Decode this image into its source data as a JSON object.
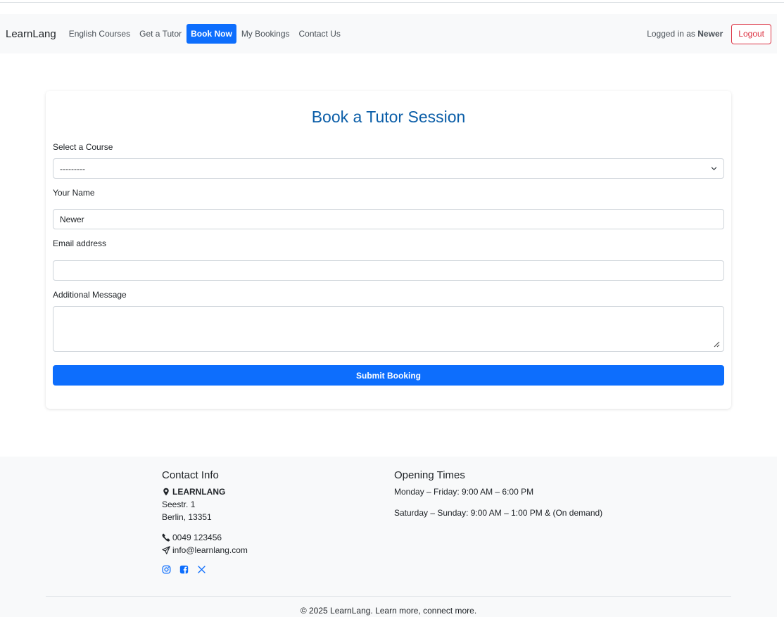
{
  "nav": {
    "brand": "LearnLang",
    "links": [
      "English Courses",
      "Get a Tutor",
      "Book Now",
      "My Bookings",
      "Contact Us"
    ],
    "active_link": "Book Now",
    "logged_in_prefix": "Logged in as",
    "username": "Newer",
    "logout_label": "Logout"
  },
  "form": {
    "title": "Book a Tutor Session",
    "course_label": "Select a Course",
    "course_value": "---------",
    "name_label": "Your Name",
    "name_value": "Newer",
    "email_label": "Email address",
    "email_value": "",
    "message_label": "Additional Message",
    "message_value": "",
    "submit_label": "Submit Booking"
  },
  "footer": {
    "contact_heading": "Contact Info",
    "company": "LEARNLANG",
    "street": "Seestr. 1",
    "city": "Berlin, 13351",
    "phone": "0049 123456",
    "email": "info@learnlang.com",
    "hours_heading": "Opening Times",
    "weekday_hours": "Monday – Friday: 9:00 AM – 6:00 PM",
    "weekend_hours": "Saturday – Sunday: 9:00 AM – 1:00 PM & (On demand)",
    "copyright": "© 2025 LearnLang. Learn more, connect more.",
    "socials": [
      "instagram-icon",
      "facebook-icon",
      "x-icon"
    ]
  },
  "colors": {
    "primary": "#0d6efd",
    "danger": "#dc3545",
    "title": "#0b5ea8",
    "footer_bg": "#f8f9fa"
  }
}
